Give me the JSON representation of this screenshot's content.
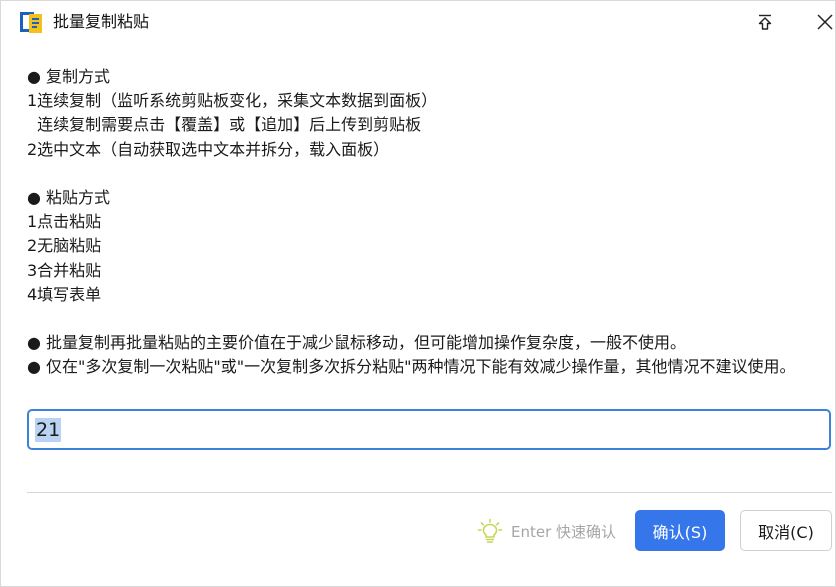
{
  "window": {
    "title": "批量复制粘贴",
    "icons": {
      "app": "clipboard-app-icon",
      "pin": "pin-top-icon",
      "close": "close-icon"
    }
  },
  "content": {
    "lines": [
      "● 复制方式",
      "1连续复制（监听系统剪贴板变化，采集文本数据到面板）",
      "  连续复制需要点击【覆盖】或【追加】后上传到剪贴板",
      "2选中文本（自动获取选中文本并拆分，载入面板）",
      "",
      "● 粘贴方式",
      "1点击粘贴",
      "2无脑粘贴",
      "3合并粘贴",
      "4填写表单",
      "",
      "● 批量复制再批量粘贴的主要价值在于减少鼠标移动，但可能增加操作复杂度，一般不使用。",
      "● 仅在\"多次复制一次粘贴\"或\"一次复制多次拆分粘贴\"两种情况下能有效减少操作量，其他情况不建议使用。"
    ]
  },
  "input": {
    "value": "21"
  },
  "footer": {
    "hint_icon": "lightbulb-icon",
    "hint_text": "Enter 快速确认",
    "confirm_label": "确认(S)",
    "cancel_label": "取消(C)"
  },
  "colors": {
    "accent": "#3577eb",
    "input_border": "#3b82d9",
    "selection": "#b9d3f3",
    "hint_icon": "#c8d65a"
  }
}
